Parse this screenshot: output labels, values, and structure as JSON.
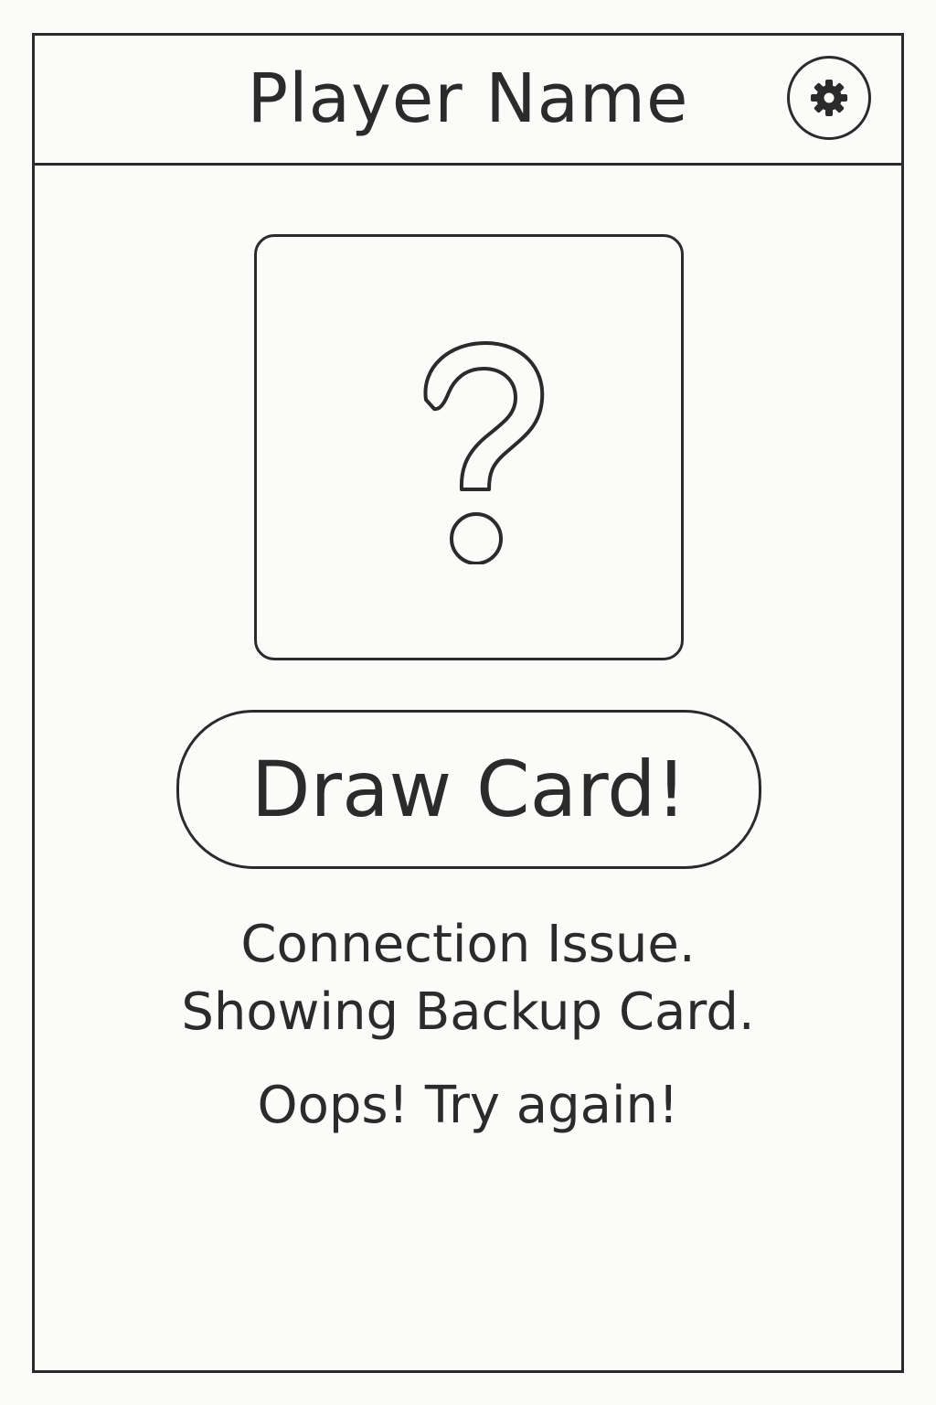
{
  "header": {
    "title": "Player Name",
    "settings_icon": "gear-icon"
  },
  "card": {
    "placeholder_icon": "question-mark-icon"
  },
  "actions": {
    "draw_label": "Draw Card!"
  },
  "status": {
    "line1": "Connection Issue.",
    "line2": "Showing Backup Card.",
    "line3": "Oops! Try again!"
  },
  "colors": {
    "ink": "#2b2b2b",
    "background": "#fbfbfa"
  }
}
